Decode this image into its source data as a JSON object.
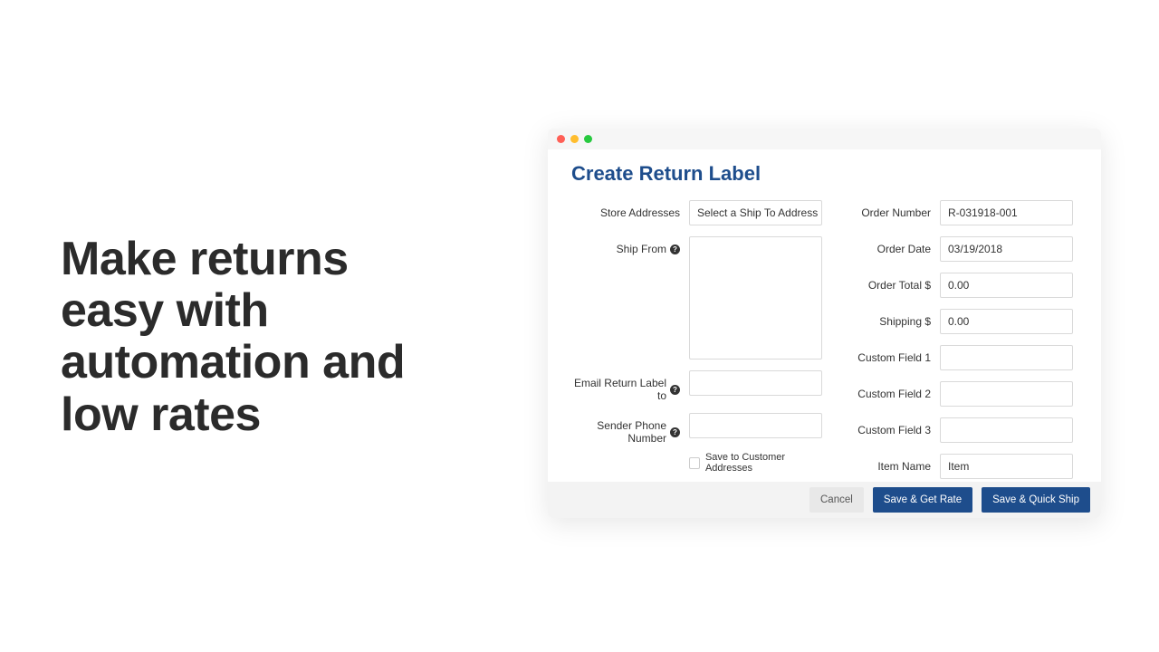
{
  "hero": {
    "headline": "Make returns easy with automation and low rates"
  },
  "panel": {
    "title": "Create Return Label"
  },
  "form": {
    "left": {
      "store_addresses_label": "Store Addresses",
      "store_addresses_select": "Select a Ship To Address",
      "ship_from_label": "Ship From",
      "ship_from_value": "",
      "email_label": "Email Return Label to",
      "email_value": "",
      "phone_label": "Sender Phone Number",
      "phone_value": "",
      "save_checkbox_label": "Save to Customer Addresses"
    },
    "right": {
      "order_number_label": "Order Number",
      "order_number_value": "R-031918-001",
      "order_date_label": "Order Date",
      "order_date_value": "03/19/2018",
      "order_total_label": "Order Total $",
      "order_total_value": "0.00",
      "shipping_label": "Shipping $",
      "shipping_value": "0.00",
      "cf1_label": "Custom Field 1",
      "cf1_value": "",
      "cf2_label": "Custom Field 2",
      "cf2_value": "",
      "cf3_label": "Custom Field 3",
      "cf3_value": "",
      "item_name_label": "Item Name",
      "item_name_value": "Item"
    }
  },
  "footer": {
    "cancel": "Cancel",
    "save_get_rate": "Save & Get Rate",
    "save_quick_ship": "Save & Quick Ship"
  }
}
